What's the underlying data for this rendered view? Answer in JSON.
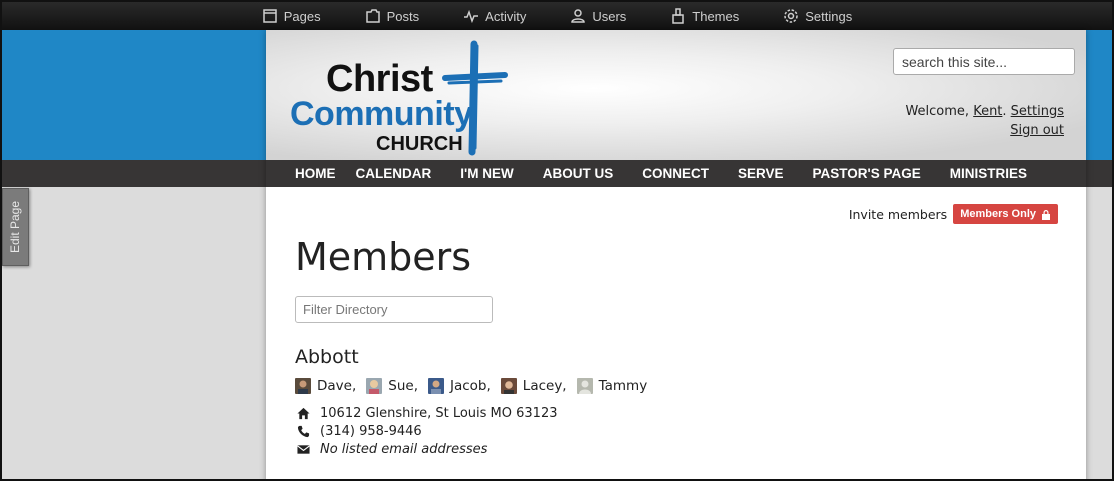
{
  "admin_bar": {
    "items": [
      {
        "label": "Pages",
        "icon": "page-icon"
      },
      {
        "label": "Posts",
        "icon": "folder-icon"
      },
      {
        "label": "Activity",
        "icon": "pulse-icon"
      },
      {
        "label": "Users",
        "icon": "users-icon"
      },
      {
        "label": "Themes",
        "icon": "brush-icon"
      },
      {
        "label": "Settings",
        "icon": "gear-icon"
      }
    ]
  },
  "logo": {
    "line1": "Christ",
    "line2": "Community",
    "line3": "CHURCH"
  },
  "search": {
    "placeholder": "search this site..."
  },
  "user": {
    "welcome": "Welcome,",
    "name": "Kent",
    "settings": "Settings",
    "signout": "Sign out"
  },
  "nav": {
    "items": [
      "HOME",
      "CALENDAR",
      "I'M NEW",
      "ABOUT US",
      "CONNECT",
      "SERVE",
      "PASTOR'S PAGE",
      "MINISTRIES"
    ]
  },
  "invite": {
    "text": "Invite members",
    "badge": "Members Only"
  },
  "page_title": "Members",
  "filter": {
    "placeholder": "Filter Directory"
  },
  "family": {
    "name": "Abbott",
    "members": [
      {
        "name": "Dave,"
      },
      {
        "name": "Sue,"
      },
      {
        "name": "Jacob,"
      },
      {
        "name": "Lacey,"
      },
      {
        "name": "Tammy"
      }
    ],
    "address": "10612 Glenshire, St Louis MO 63123",
    "phone": "(314) 958-9446",
    "email": "No listed email addresses"
  },
  "edit_tab": "Edit Page",
  "colors": {
    "brand_blue": "#1f87c6",
    "nav_dark": "#373535",
    "badge_red": "#d64541"
  }
}
